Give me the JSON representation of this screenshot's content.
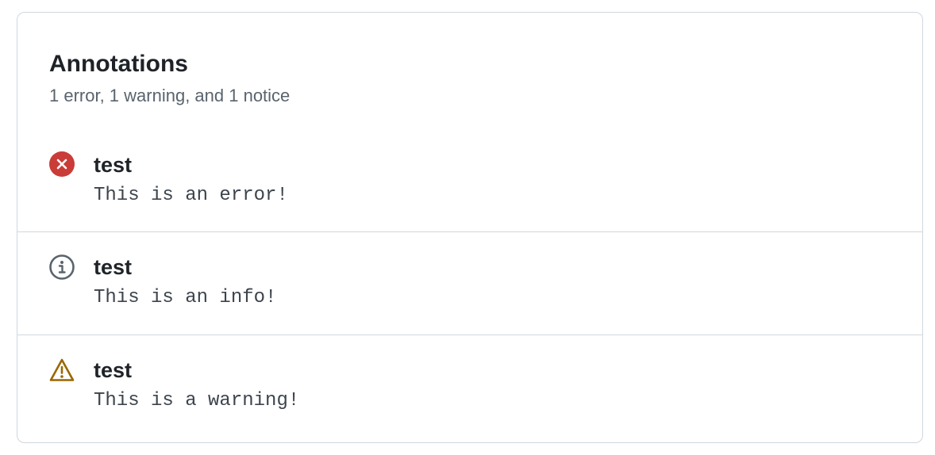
{
  "annotations": {
    "title": "Annotations",
    "summary": "1 error, 1 warning, and 1 notice",
    "items": [
      {
        "type": "error",
        "icon": "x-circle-fill-icon",
        "title": "test",
        "message": "This is an error!",
        "color": "#cf222e"
      },
      {
        "type": "notice",
        "icon": "info-icon",
        "title": "test",
        "message": "This is an info!",
        "color": "#59636e"
      },
      {
        "type": "warning",
        "icon": "alert-icon",
        "title": "test",
        "message": "This is a warning!",
        "color": "#9a6700"
      }
    ]
  }
}
